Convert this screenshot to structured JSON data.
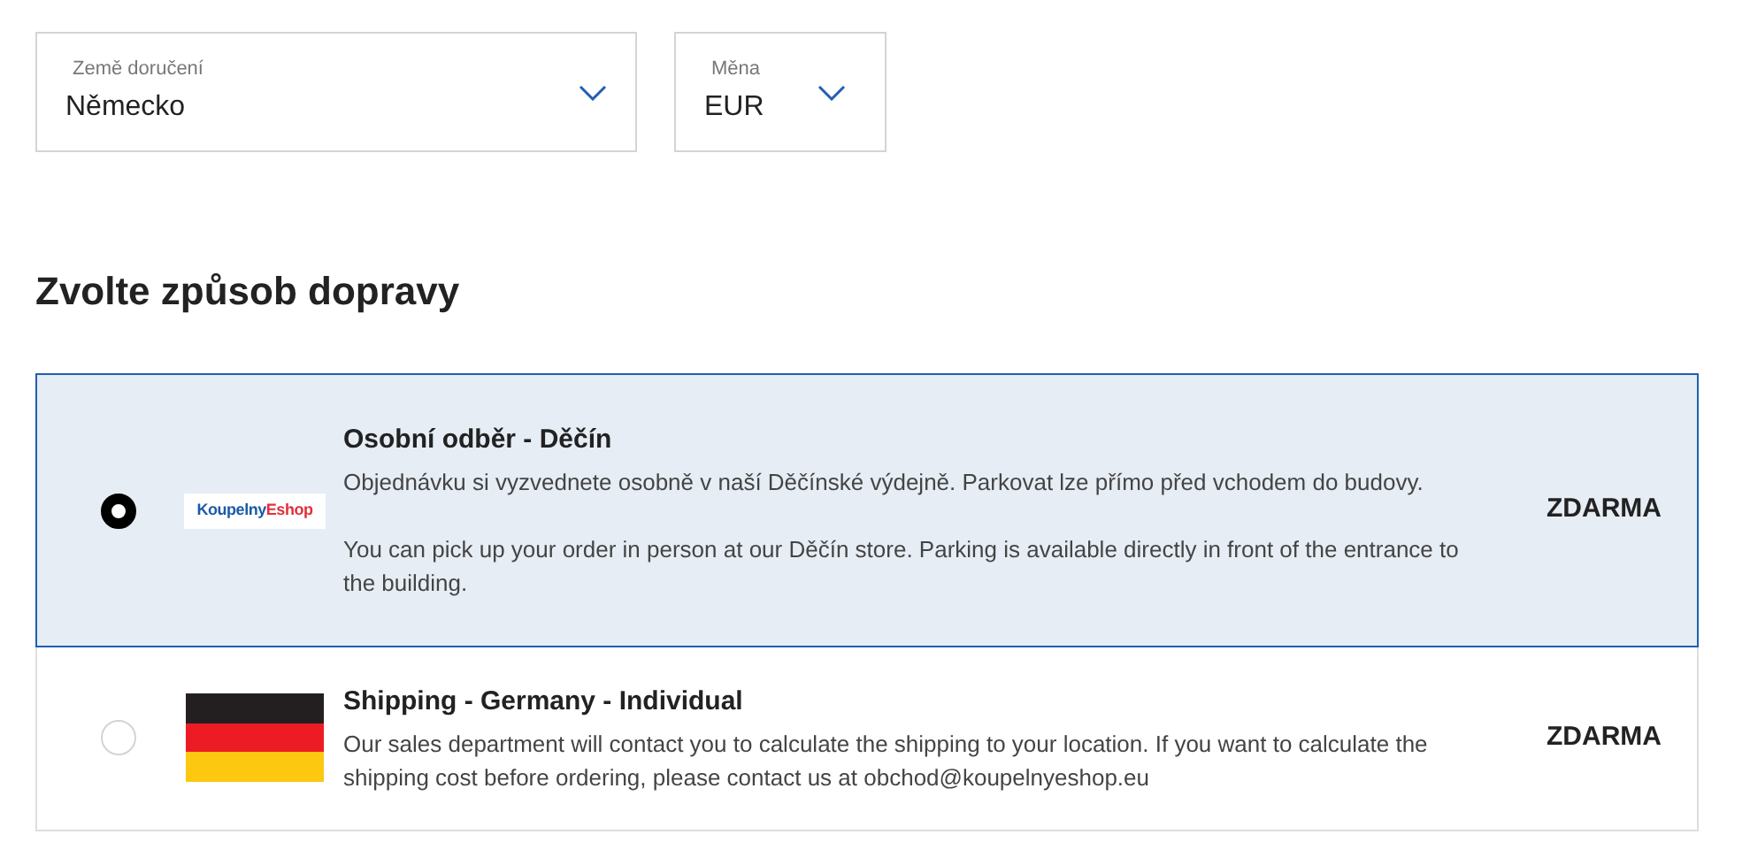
{
  "selects": [
    {
      "label": "Země doručení",
      "value": "Německo"
    },
    {
      "label": "Měna",
      "value": "EUR"
    }
  ],
  "heading": "Zvolte způsob dopravy",
  "options": [
    {
      "selected": true,
      "image": {
        "kind": "logo",
        "text_1": "Koupelny",
        "text_2": "Eshop"
      },
      "title": "Osobní odběr - Děčín",
      "description": [
        "Objednávku si vyzvednete osobně v naší Děčínské výdejně. Parkovat lze přímo před vchodem do budovy.",
        "You can pick up your order in person at our Děčín store. Parking is available directly in front of the entrance to the building."
      ],
      "price": "ZDARMA"
    },
    {
      "selected": false,
      "image": {
        "kind": "flag"
      },
      "title": "Shipping - Germany - Individual",
      "description": [
        "Our sales department will contact you to calculate the shipping to your location. If you want to calculate the shipping cost before ordering, please contact us at obchod@koupelnyeshop.eu"
      ],
      "price": "ZDARMA"
    }
  ]
}
